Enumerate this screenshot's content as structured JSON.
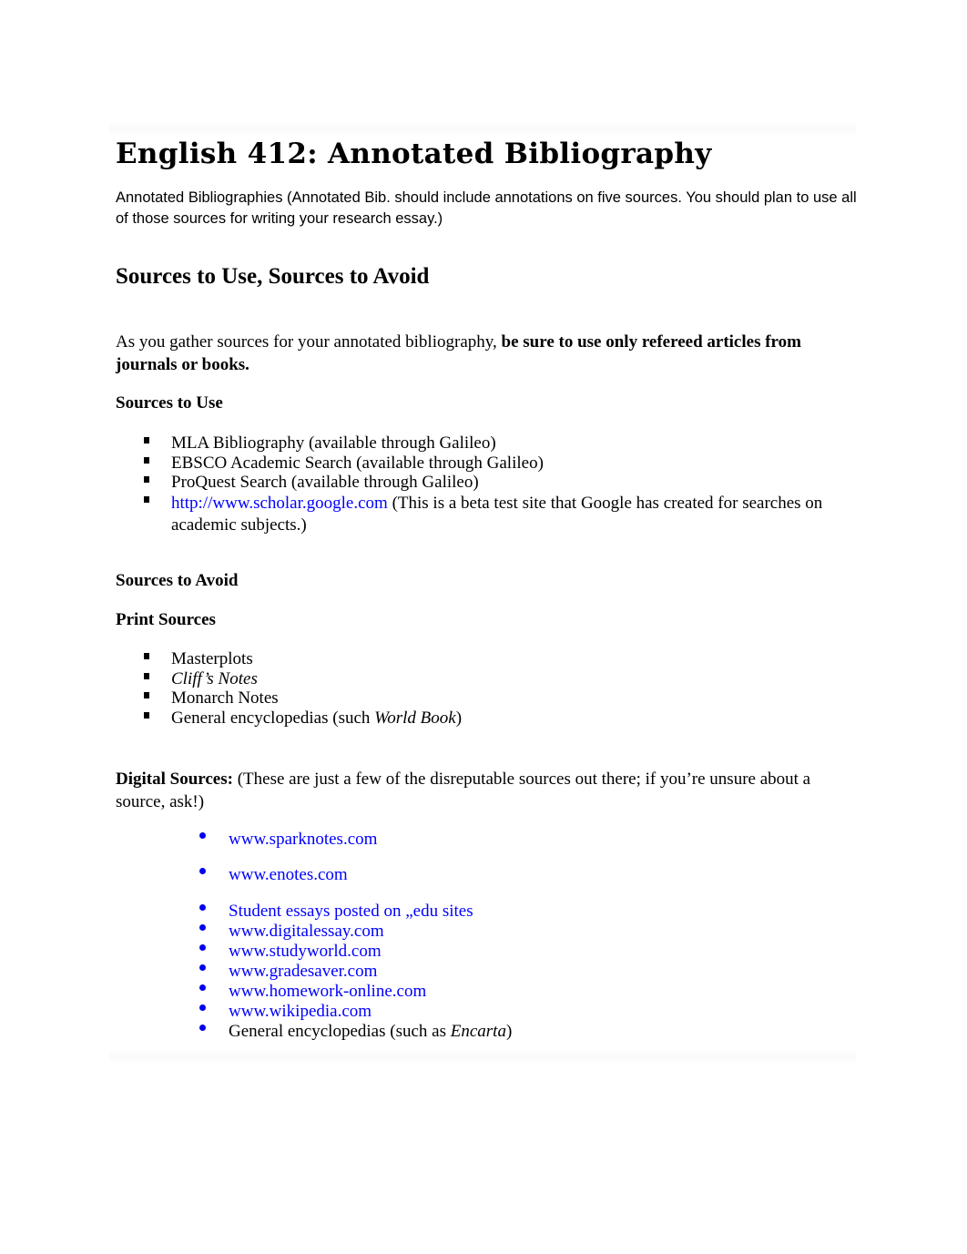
{
  "document": {
    "title": "English 412: Annotated Bibliography",
    "intro": " Annotated Bibliographies (Annotated Bib. should include annotations on five sources. You should plan to use all of those sources for writing your research essay.)",
    "section_heading": "Sources to Use, Sources to Avoid",
    "guidance": {
      "lead": "As you gather sources for your annotated bibliography, ",
      "emphasis": "be sure to use only refereed articles from journals or books."
    },
    "sources_to_use": {
      "heading": "Sources to Use",
      "items": [
        {
          "text": "MLA Bibliography (available through Galileo)"
        },
        {
          "text": "EBSCO Academic Search (available through Galileo)"
        },
        {
          "text": "ProQuest Search (available through Galileo)"
        },
        {
          "link": "http://www.scholar.google.com",
          "text": " (This is a beta test site that Google has created for searches on academic subjects.)"
        }
      ]
    },
    "sources_to_avoid": {
      "heading": "Sources to Avoid",
      "print": {
        "heading": "Print Sources",
        "items": [
          {
            "text": "Masterplots"
          },
          {
            "italic": "Cliff’s Notes"
          },
          {
            "text": "Monarch Notes"
          },
          {
            "text": "General encyclopedias (such ",
            "italic": "World Book",
            "suffix": ")"
          }
        ]
      },
      "digital": {
        "heading": "Digital Sources:",
        "note": " (These are just a few of the disreputable sources out there; if you’re unsure about a source, ask!)",
        "items": [
          {
            "link": "www.sparknotes.com"
          },
          {
            "link": "www.enotes.com"
          },
          {
            "link": "Student essays posted on „edu sites"
          },
          {
            "link": "www.digitalessay.com"
          },
          {
            "link": "www.studyworld.com"
          },
          {
            "link": "www.gradesaver.com"
          },
          {
            "link": "www.homework-online.com"
          },
          {
            "link": "www.wikipedia.com"
          },
          {
            "text": "General encyclopedias (such as ",
            "italic": "Encarta",
            "suffix": ")"
          }
        ]
      }
    },
    "colors": {
      "link": "#0000ff",
      "text": "#000000",
      "digital_bullet": "#0000ee"
    }
  }
}
